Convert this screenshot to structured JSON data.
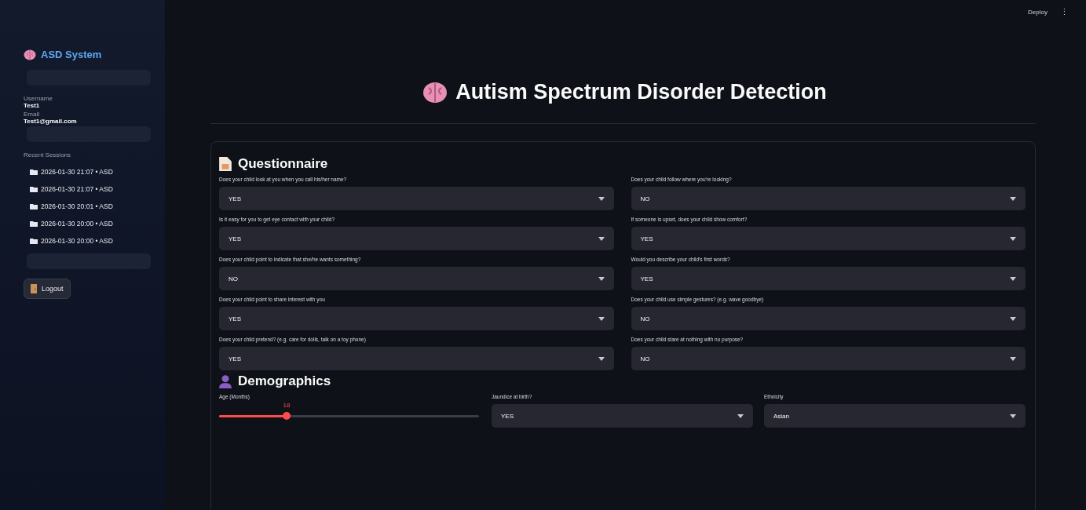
{
  "sidebar": {
    "brand": "ASD System",
    "username_label": "Username",
    "username": "Test1",
    "email_label": "Email",
    "email": "Test1@gmail.com",
    "sessions_label": "Recent Sessions",
    "sessions": [
      {
        "label": "2026-01-30 21:07 • ASD"
      },
      {
        "label": "2026-01-30 21:07 • ASD"
      },
      {
        "label": "2026-01-30 20:01 • ASD"
      },
      {
        "label": "2026-01-30 20:00 • ASD"
      },
      {
        "label": "2026-01-30 20:00 • ASD"
      }
    ],
    "logout": "Logout"
  },
  "header": {
    "deploy": "Deploy",
    "menu": "⋮"
  },
  "title": "Autism Spectrum Disorder Detection",
  "questionnaire": {
    "heading": "Questionnaire",
    "questions": [
      {
        "label": "Does your child look at you when you call his/her name?",
        "value": "YES"
      },
      {
        "label": "Does your child follow where you're looking?",
        "value": "NO"
      },
      {
        "label": "Is it easy for you to get eye contact with your child?",
        "value": "YES"
      },
      {
        "label": "If someone is upset, does your child show comfort?",
        "value": "YES"
      },
      {
        "label": "Does your child point to indicate that she/he wants something?",
        "value": "NO"
      },
      {
        "label": "Would you describe your child's first words?",
        "value": "YES"
      },
      {
        "label": "Does your child point to share interest with you",
        "value": "YES"
      },
      {
        "label": "Does your child use simple gestures? (e.g. wave goodbye)",
        "value": "NO"
      },
      {
        "label": "Does your child pretend? (e.g. care for dolls, talk on a toy phone)",
        "value": "YES"
      },
      {
        "label": "Does your child stare at nothing with no purpose?",
        "value": "NO"
      }
    ]
  },
  "demographics": {
    "heading": "Demographics",
    "age": {
      "label": "Age (Months)",
      "value": "18",
      "level": 0.26
    },
    "fields": [
      {
        "label": "Jaundice at birth?",
        "value": "YES"
      },
      {
        "label": "Ethnicity",
        "value": "Asian"
      }
    ]
  }
}
